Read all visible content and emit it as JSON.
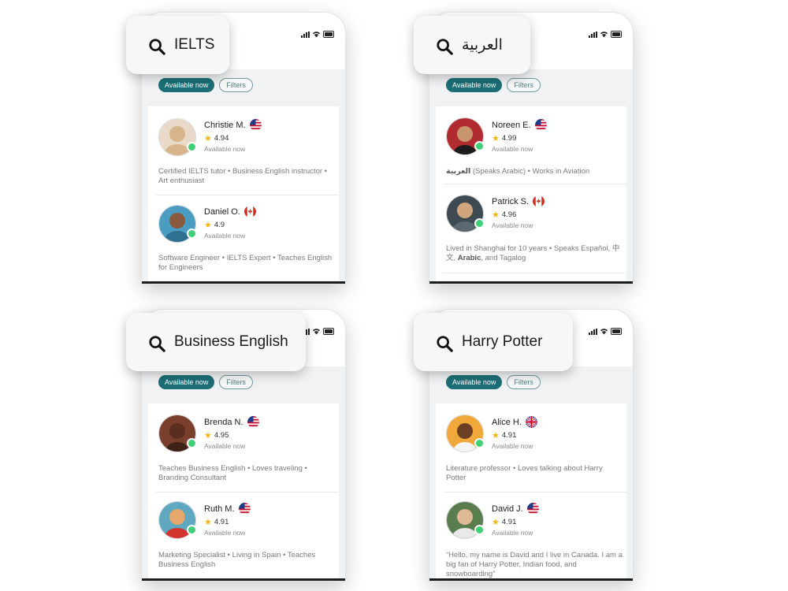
{
  "common": {
    "available_chip": "Available now",
    "filters_chip": "Filters"
  },
  "panels": [
    {
      "search_query": "IELTS",
      "tutors": [
        {
          "name": "Christie M.",
          "flag": "us",
          "rating": "4.94",
          "status": "Available now",
          "description": "Certified IELTS tutor • Business English instructor • Art enthusiast",
          "avatar_bg": "#e8d9c8",
          "avatar_fg": "#d8b48a"
        },
        {
          "name": "Daniel O.",
          "flag": "ca",
          "rating": "4.9",
          "status": "Available now",
          "description": "Software Engineer • IELTS Expert • Teaches English for Engineers",
          "avatar_bg": "#4a9cc2",
          "avatar_fg": "#8a5a3c"
        }
      ]
    },
    {
      "search_query": "العربية",
      "tutors": [
        {
          "name": "Noreen E.",
          "flag": "us",
          "rating": "4.99",
          "status": "Available now",
          "description_pre": "",
          "description_bold": "العربية",
          "description_post": " (Speaks Arabic) • Works in Aviation",
          "avatar_bg": "#b02c31",
          "avatar_fg": "#c9956c"
        },
        {
          "name": "Patrick S.",
          "flag": "ca",
          "rating": "4.96",
          "status": "Available now",
          "description_pre": "Lived in Shanghai for 10 years • Speaks Español, 中文, ",
          "description_bold": "Arabic",
          "description_post": ", and Tagalog",
          "avatar_bg": "#3d4a52",
          "avatar_fg": "#d1a57d"
        }
      ]
    },
    {
      "search_query": "Business English",
      "tutors": [
        {
          "name": "Brenda N.",
          "flag": "us",
          "rating": "4.95",
          "status": "Available now",
          "description": "Teaches Business English • Loves traveling • Branding Consultant",
          "avatar_bg": "#7a3f2c",
          "avatar_fg": "#5a2e1e"
        },
        {
          "name": "Ruth M.",
          "flag": "us",
          "rating": "4.91",
          "status": "Available now",
          "description": "Marketing Specialist • Living in Spain • Teaches Business English",
          "avatar_bg": "#5fa8c0",
          "avatar_fg": "#e5a76c"
        }
      ]
    },
    {
      "search_query": "Harry Potter",
      "tutors": [
        {
          "name": "Alice H.",
          "flag": "uk",
          "rating": "4.91",
          "status": "Available now",
          "description": "Literature professor • Loves talking about Harry Potter",
          "avatar_bg": "#f0a83a",
          "avatar_fg": "#6b3e26"
        },
        {
          "name": "David J.",
          "flag": "us",
          "rating": "4.91",
          "status": "Available now",
          "description": "“Hello, my name is David and I live in Canada. I am a big fan of Harry Potter, Indian food, and snowboarding”",
          "avatar_bg": "#5a7d4f",
          "avatar_fg": "#e0b995"
        }
      ]
    }
  ],
  "colors": {
    "primary_chip": "#1c6e76",
    "online_dot": "#3fd076",
    "star": "#f5b615"
  }
}
